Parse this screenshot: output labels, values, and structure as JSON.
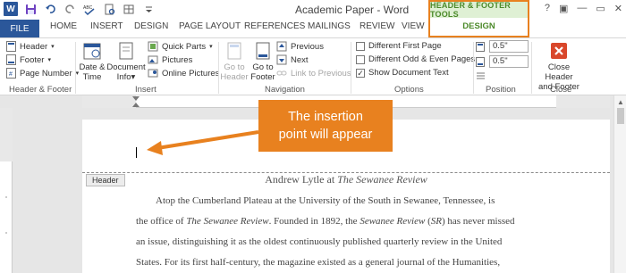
{
  "title_bar": {
    "app_icon": "W",
    "document_title": "Academic Paper - Word",
    "help": "?",
    "ribbon_options": "▣",
    "minimize": "—",
    "restore": "▭",
    "close": "✕"
  },
  "quick_access": [
    "save-icon",
    "undo-icon",
    "redo-icon",
    "spelling-icon",
    "print-preview-icon",
    "draw-table-icon",
    "customize-icon"
  ],
  "contextual_tab": {
    "group_title": "HEADER & FOOTER TOOLS",
    "tab_label": "DESIGN",
    "highlight_color": "#e8811f",
    "accent_color": "#4c8a2a"
  },
  "tabs": [
    "FILE",
    "HOME",
    "INSERT",
    "DESIGN",
    "PAGE LAYOUT",
    "REFERENCES",
    "MAILINGS",
    "REVIEW",
    "VIEW"
  ],
  "ribbon": {
    "header_footer": {
      "header": "Header",
      "footer": "Footer",
      "page_number": "Page Number",
      "group_label": "Header & Footer"
    },
    "insert": {
      "date_time": "Date &",
      "date_time2": "Time",
      "document_info": "Document",
      "document_info2": "Info",
      "quick_parts": "Quick Parts",
      "pictures": "Pictures",
      "online_pictures": "Online Pictures",
      "group_label": "Insert"
    },
    "navigation": {
      "go_to_header": "Go to",
      "go_to_header2": "Header",
      "go_to_footer": "Go to",
      "go_to_footer2": "Footer",
      "previous": "Previous",
      "next": "Next",
      "link_to_previous": "Link to Previous",
      "group_label": "Navigation"
    },
    "options": {
      "different_first_page": "Different First Page",
      "different_odd_even": "Different Odd & Even Pages",
      "show_document_text": "Show Document Text",
      "show_document_text_checked": true,
      "group_label": "Options"
    },
    "position": {
      "header_top": "0.5\"",
      "footer_bottom": "0.5\"",
      "group_label": "Position"
    },
    "close": {
      "label1": "Close Header",
      "label2": "and Footer",
      "group_label": "Close"
    }
  },
  "document": {
    "header_tag": "Header",
    "title_plain": "Andrew Lytle at ",
    "title_italic": "The Sewanee Review",
    "paragraph": [
      [
        "Atop the Cumberland Plateau at the University of the South in Sewanee, Tennessee, is"
      ],
      [
        "the office of ",
        "The Sewanee Review",
        ". Founded in 1892, the ",
        "Sewanee Review",
        " (",
        "SR",
        ") has never missed"
      ],
      [
        "an issue, distinguishing it as the oldest continuously published quarterly review in the United"
      ],
      [
        "States. For its first half-century, the magazine existed as a general journal of the Humanities,"
      ]
    ]
  },
  "callout": {
    "line1": "The insertion",
    "line2": "point will appear"
  }
}
